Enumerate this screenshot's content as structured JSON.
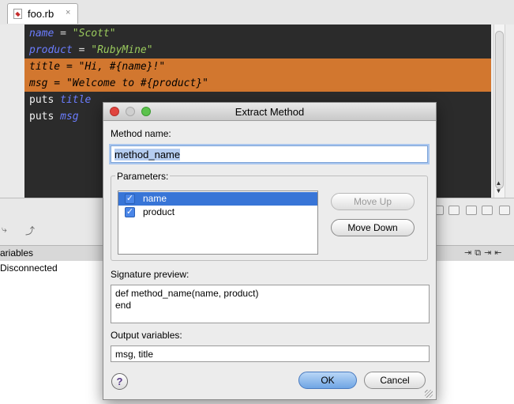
{
  "editor": {
    "tab_label": "foo.rb",
    "tab_close": "×",
    "lines": [
      {
        "ident": "name",
        "op": " = ",
        "value": "\"Scott\""
      },
      {
        "ident": "product",
        "op": " = ",
        "value": "\"RubyMine\""
      },
      {
        "ident": "title",
        "op": " = ",
        "value": "\"Hi, #{name}!\""
      },
      {
        "ident": "msg",
        "op": " = ",
        "value": "\"Welcome to #{product}\""
      },
      {
        "kw": "puts ",
        "ident": "title"
      },
      {
        "kw": "puts ",
        "ident": "msg"
      }
    ]
  },
  "debug": {
    "variables_label": "ariables",
    "status": "Disconnected"
  },
  "dialog": {
    "title": "Extract Method",
    "method_name_label": "Method name:",
    "method_name_value": "method_name",
    "parameters_label": "Parameters:",
    "parameters": [
      {
        "name": "name",
        "checked": true,
        "selected": true
      },
      {
        "name": "product",
        "checked": true,
        "selected": false
      }
    ],
    "move_up_label": "Move Up",
    "move_down_label": "Move Down",
    "signature_label": "Signature preview:",
    "signature_text": "def method_name(name, product)\nend",
    "output_label": "Output variables:",
    "output_value": "msg, title",
    "ok_label": "OK",
    "cancel_label": "Cancel",
    "help_glyph": "?"
  }
}
